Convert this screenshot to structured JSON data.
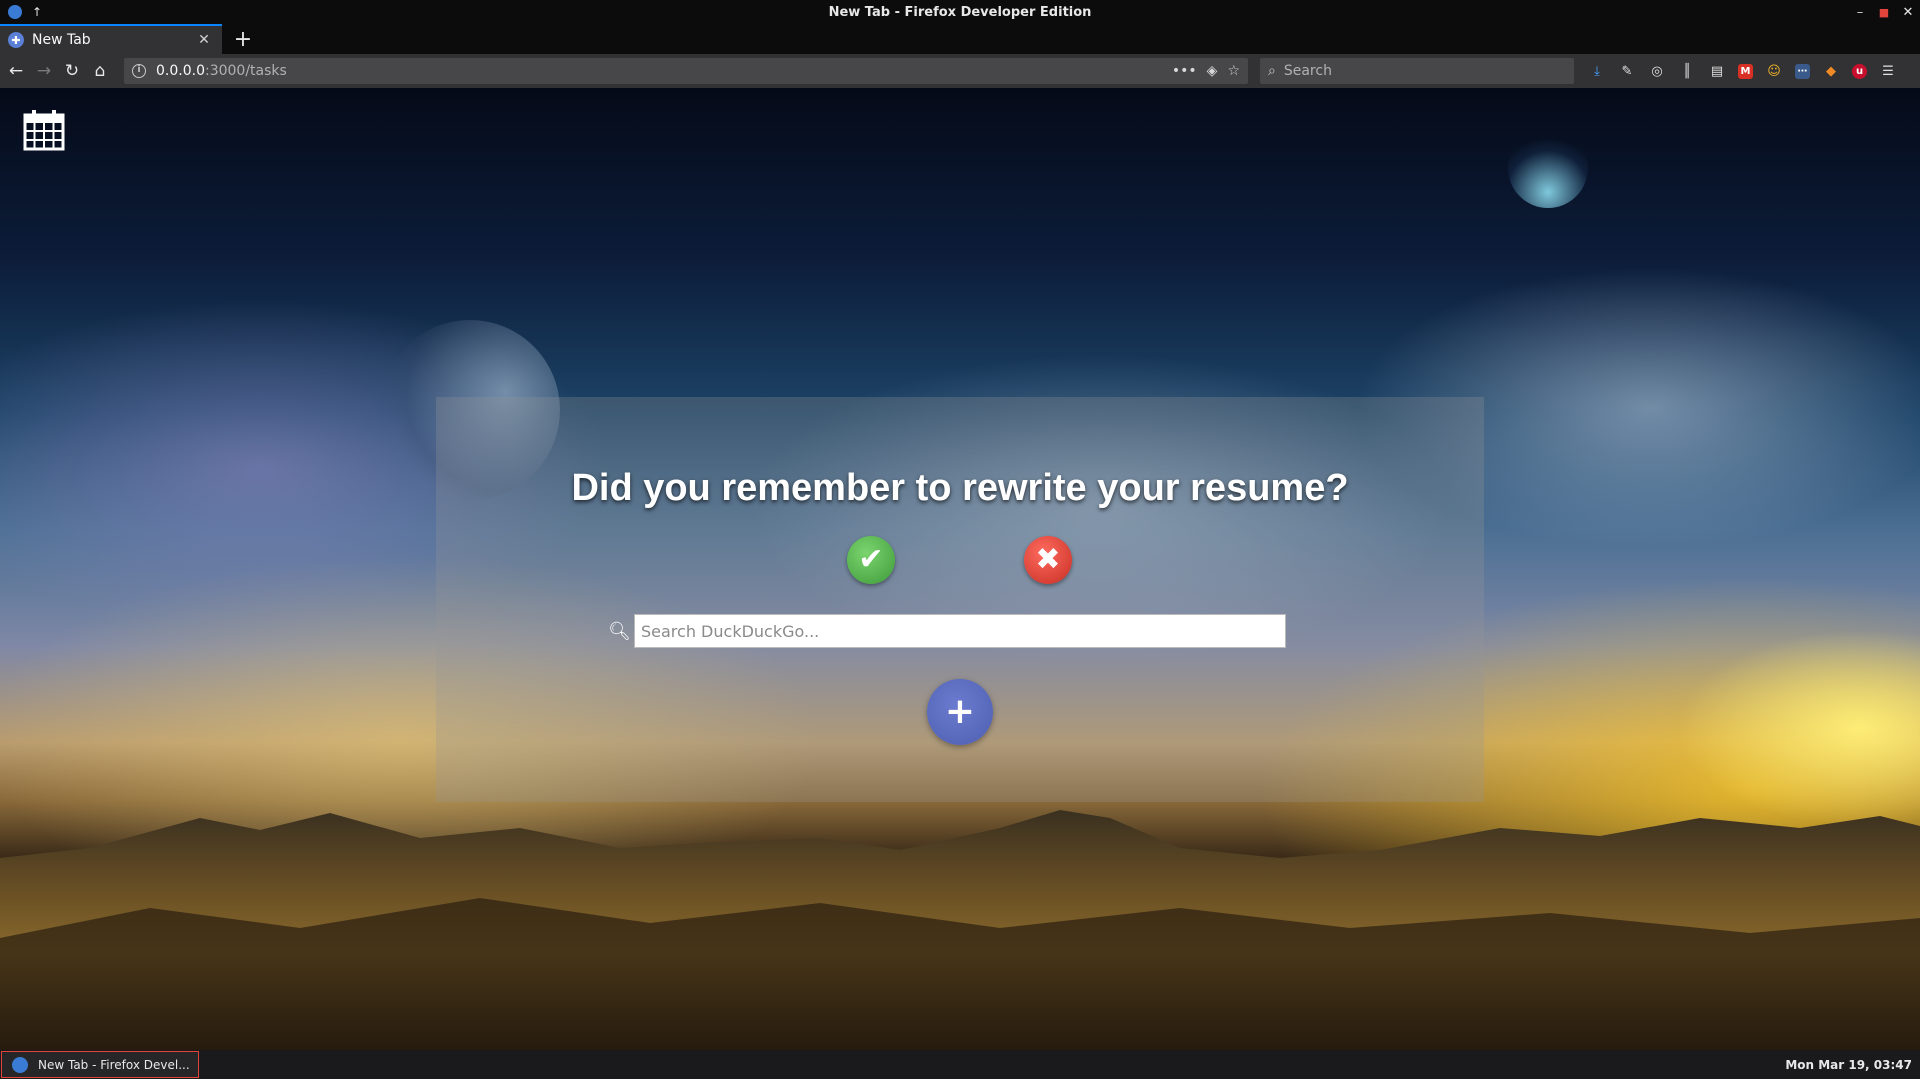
{
  "window": {
    "title": "New Tab - Firefox Developer Edition"
  },
  "tabs": [
    {
      "label": "New Tab",
      "active": true
    }
  ],
  "navbar": {
    "url_host": "0.0.0.0",
    "url_path": ":3000/tasks",
    "search_placeholder": "Search"
  },
  "page": {
    "question": "Did you remember to rewrite your resume?",
    "search_placeholder": "Search DuckDuckGo..."
  },
  "taskbar": {
    "task_label": "New Tab - Firefox Devel...",
    "clock": "Mon Mar 19, 03:47"
  },
  "colors": {
    "accent": "#0a84ff",
    "yes": "#4caf50",
    "no": "#e53935",
    "add": "#5c6bc0"
  }
}
